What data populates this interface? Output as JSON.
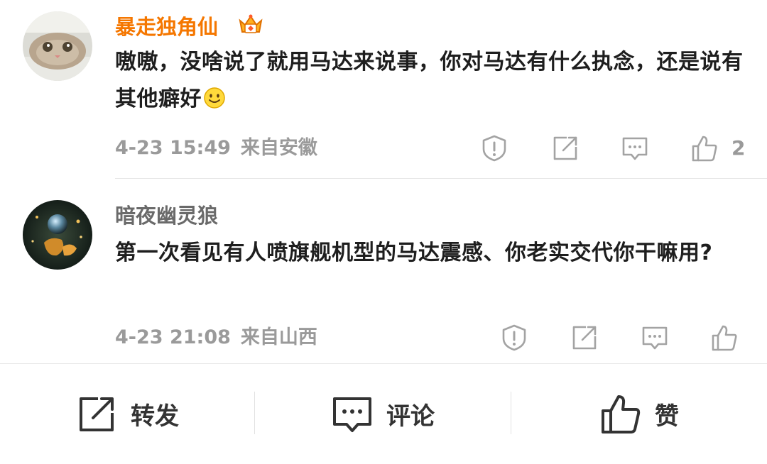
{
  "comments": [
    {
      "username": "暴走独角仙",
      "text": "嗷嗷，没啥说了就用马达来说事，你对马达有什么执念，还是说有其他癖好",
      "time": "4-23 15:49",
      "location": "来自安徽",
      "likes": "2",
      "avatar": "cat-avatar",
      "badge": "vip-crown-icon",
      "emoji": "smile-emoji"
    },
    {
      "username": "暗夜幽灵狼",
      "text": "第一次看见有人喷旗舰机型的马达震感、你老实交代你干嘛用?",
      "time": "4-23 21:08",
      "location": "来自山西",
      "likes": "",
      "avatar": "glass-sphere-avatar"
    }
  ],
  "bottom_bar": {
    "repost_label": "转发",
    "comment_label": "评论",
    "like_label": "赞"
  },
  "colors": {
    "vip_name": "#f57700",
    "normal_name": "#6a6a6a",
    "meta": "#9a9a9a",
    "text": "#1e1e1e"
  }
}
